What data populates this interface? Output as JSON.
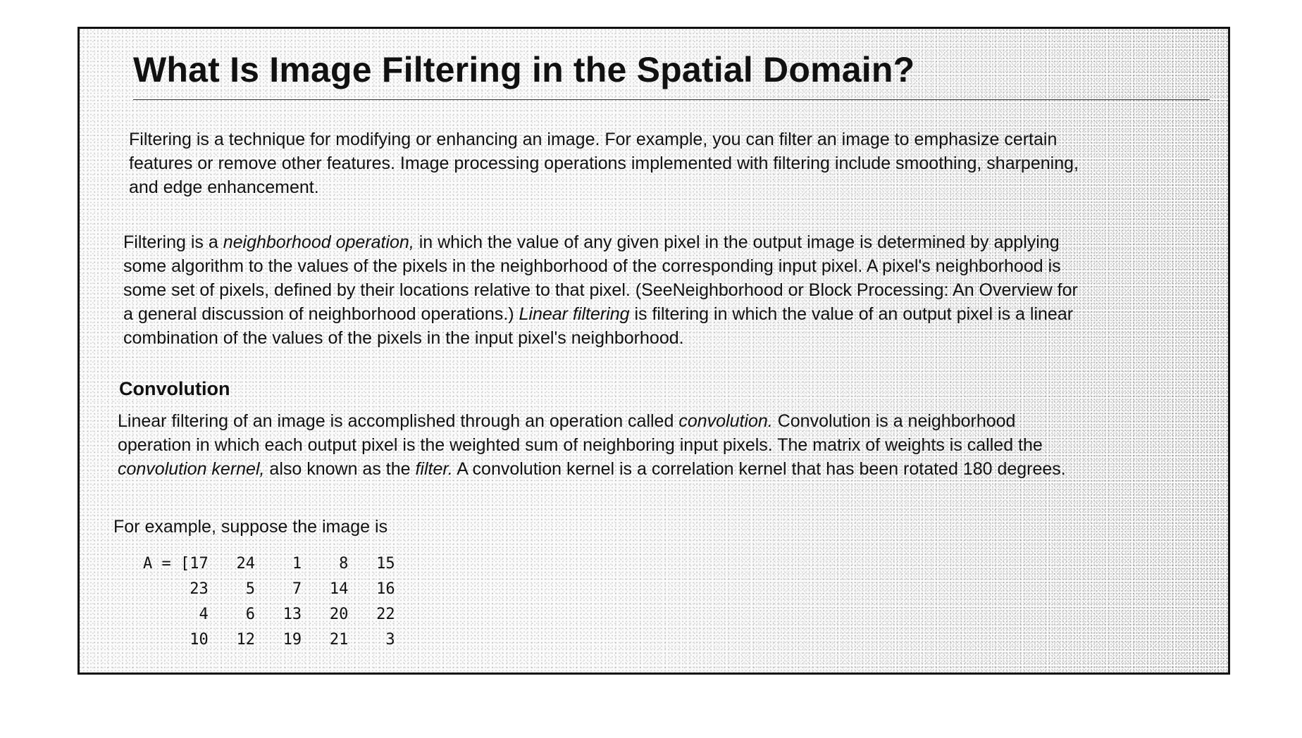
{
  "page": {
    "title": "What Is Image Filtering in the Spatial Domain?",
    "paragraph1": {
      "lines": [
        "Filtering is a technique for modifying or enhancing an image. For example, you can filter an image to emphasize certain",
        "features or remove other features. Image processing operations implemented with filtering include smoothing, sharpening,",
        "and edge enhancement."
      ]
    },
    "paragraph2": {
      "line1_prefix": "Filtering is a ",
      "line1_italic": "neighborhood operation,",
      "line1_suffix": " in which the value of any given pixel in the output image is determined by applying",
      "line2": "some algorithm to the values of the pixels in the neighborhood of the corresponding input pixel. A pixel's neighborhood is",
      "line3": "some set of pixels, defined by their locations relative to that pixel. (SeeNeighborhood or Block Processing: An Overview for",
      "line4_prefix": "a general discussion of neighborhood operations.) ",
      "line4_italic": "Linear filtering",
      "line4_suffix": " is filtering in which the value of an output pixel is a linear",
      "line5": "combination of the values of the pixels in the input pixel's neighborhood."
    },
    "section_heading": "Convolution",
    "paragraph3": {
      "line1_prefix": "Linear filtering of an image is accomplished through an operation called ",
      "line1_italic": "convolution.",
      "line1_suffix": " Convolution is a neighborhood",
      "line2": "operation in which each output pixel is the weighted sum of neighboring input pixels. The matrix of weights is called the",
      "line3_italic1": "convolution kernel,",
      "line3_mid": " also known as the ",
      "line3_italic2": "filter.",
      "line3_suffix": " A convolution kernel is a correlation kernel that has been rotated 180 degrees."
    },
    "paragraph4": "For example, suppose the image is",
    "code_lines": [
      "A = [17   24    1    8   15",
      "     23    5    7   14   16",
      "      4    6   13   20   22",
      "     10   12   19   21    3"
    ]
  }
}
